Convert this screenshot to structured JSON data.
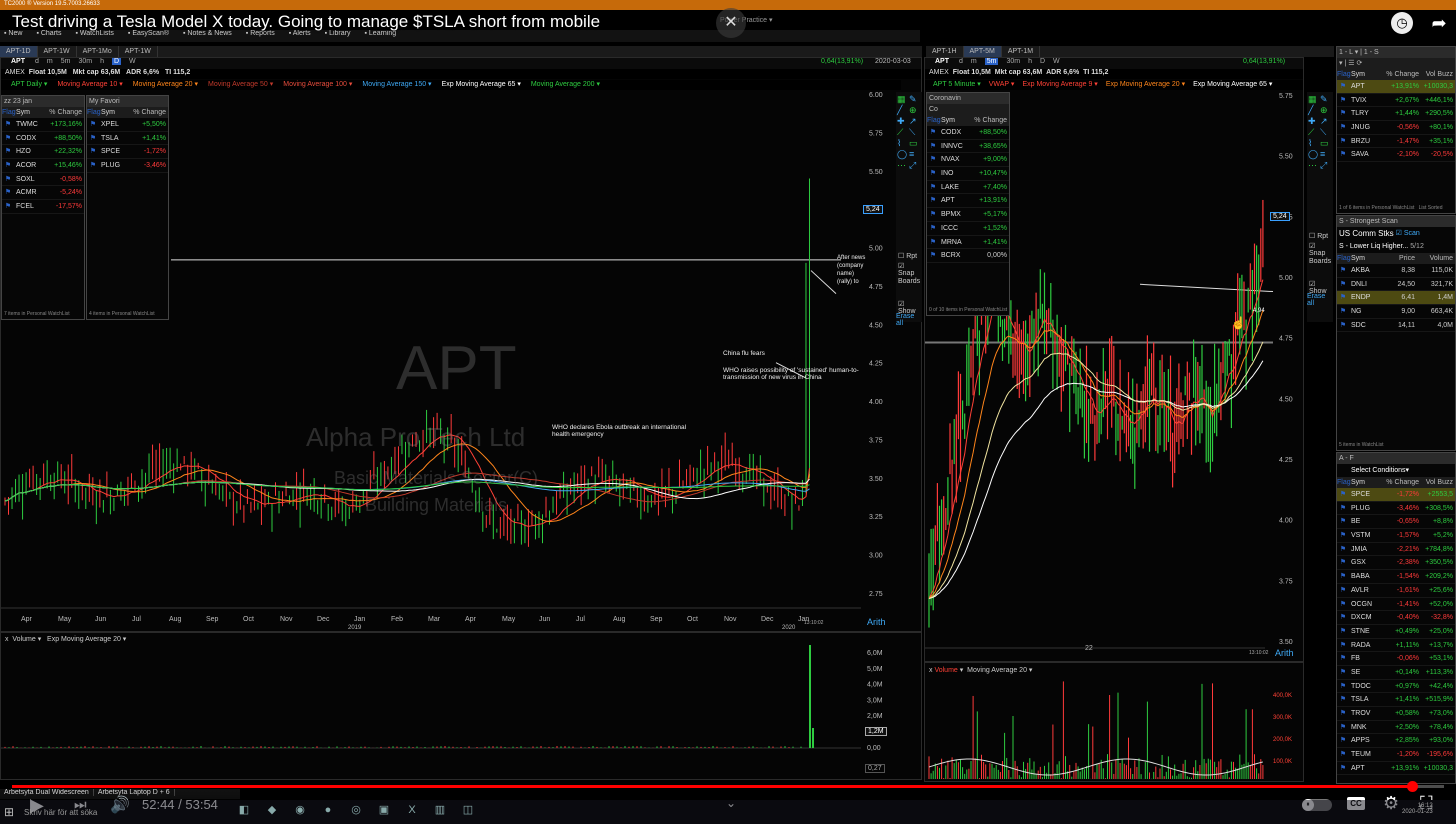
{
  "app_title": "TC2000 ® Version 19.5.7003.26633",
  "video_title": "Test driving a Tesla Model X today. Going to manage $TSLA short from mobile",
  "top_menu": [
    "New",
    "Charts",
    "WatchLists",
    "EasyScan®",
    "Notes & News",
    "Reports",
    "Alerts",
    "Library",
    "Learning"
  ],
  "layout_label": "Power Practice",
  "left_tabs": [
    "APT-1D",
    "APT-1W",
    "APT-1Mo",
    "APT-1W"
  ],
  "right_tabs": [
    "APT-1H",
    "APT-5M",
    "APT-1M"
  ],
  "left_chart": {
    "symbol": "APT",
    "timeframes": [
      "d",
      "m",
      "5m",
      "30m",
      "h",
      "D",
      "W"
    ],
    "exchange": "AMEX",
    "float": "Float 10,5M",
    "mktcap": "Mkt cap 63,6M",
    "adr": "ADR 6,6%",
    "ti": "TI 115,2",
    "price_label": "0,64(13,91%)",
    "date_label": "2020-03-03",
    "indicators": [
      "APT Daily",
      "Moving Average 10",
      "Moving Average 20",
      "Moving Average 50",
      "Moving Average 100",
      "Moving Average 150",
      "Exp Moving Average 65",
      "Moving Average 200"
    ],
    "indicator_colors": [
      "#2ecc40",
      "#ff4136",
      "#ff851b",
      "#c0392b",
      "#e74c3c",
      "#3fa9f5",
      "#ffffff",
      "#2ecc40"
    ],
    "watermark": {
      "symbol": "APT",
      "company": "Alpha Pro Tech Ltd",
      "sector": "Basic Materials Sector(C)",
      "industry": "Building Materials"
    },
    "y_ticks": [
      "6.00",
      "5.75",
      "5.50",
      "5.25",
      "5.00",
      "4.75",
      "4.50",
      "4.25",
      "4.00",
      "3.75",
      "3.50",
      "3.25",
      "3.00",
      "2.75"
    ],
    "price_tag": "5,24",
    "x_ticks": [
      "Apr",
      "May",
      "Jun",
      "Jul",
      "Aug",
      "Sep",
      "Oct",
      "Nov",
      "Dec",
      "Jan",
      "Feb",
      "Mar",
      "Apr",
      "May",
      "Jun",
      "Jul",
      "Aug",
      "Sep",
      "Oct",
      "Nov",
      "Dec",
      "Jan"
    ],
    "x_years": [
      "2019",
      "2020"
    ],
    "scale": "Arith",
    "annotations": [
      "WHO declares Ebola outbreak an international health emergency",
      "China flu fears",
      "WHO raises possibility of 'sustained' human-to-transmission of new virus in China",
      "After news",
      "(company name)",
      "(rally) to"
    ],
    "volume_label": "Volume",
    "volume_ma": "Exp Moving Average 20",
    "vol_ticks": [
      "6,0M",
      "5,0M",
      "4,0M",
      "3,0M",
      "2,0M",
      "1,0M",
      "0,00"
    ],
    "vol_tag": "1,2M",
    "time_label": "13:10:02",
    "small_tag": "0,27"
  },
  "left_watch1": {
    "title": "zz 23 jan",
    "cols": [
      "Flag",
      "Sym",
      "% Change"
    ],
    "rows": [
      {
        "sym": "TWMC",
        "chg": "+173,16%",
        "dir": "pos"
      },
      {
        "sym": "CODX",
        "chg": "+88,50%",
        "dir": "pos"
      },
      {
        "sym": "HZO",
        "chg": "+22,32%",
        "dir": "pos"
      },
      {
        "sym": "ACOR",
        "chg": "+15,46%",
        "dir": "pos"
      },
      {
        "sym": "SOXL",
        "chg": "-0,58%",
        "dir": "neg"
      },
      {
        "sym": "ACMR",
        "chg": "-5,24%",
        "dir": "neg"
      },
      {
        "sym": "FCEL",
        "chg": "-17,57%",
        "dir": "neg"
      }
    ],
    "footer": "7 items in Personal WatchList"
  },
  "left_watch2": {
    "title": "My Favori",
    "cols": [
      "Flag",
      "Sym",
      "% Change"
    ],
    "rows": [
      {
        "sym": "XPEL",
        "chg": "+5,50%",
        "dir": "pos"
      },
      {
        "sym": "TSLA",
        "chg": "+1,41%",
        "dir": "pos"
      },
      {
        "sym": "SPCE",
        "chg": "-1,72%",
        "dir": "neg"
      },
      {
        "sym": "PLUG",
        "chg": "-3,46%",
        "dir": "neg"
      }
    ],
    "footer": "4 items in Personal WatchList"
  },
  "right_chart": {
    "symbol": "APT",
    "timeframes": [
      "d",
      "m",
      "5m",
      "30m",
      "h",
      "D",
      "W"
    ],
    "exchange": "AMEX",
    "float": "Float 10,5M",
    "mktcap": "Mkt cap 63,6M",
    "adr": "ADR 6,6%",
    "ti": "TI 115,2",
    "price_label": "0,64(13,91%)",
    "date_label": "2020-03-03",
    "indicators": [
      "APT 5 Minute",
      "VWAP",
      "Exp Moving Average 9",
      "Exp Moving Average 20",
      "Exp Moving Average 65"
    ],
    "y_ticks": [
      "5.75",
      "5.50",
      "5.25",
      "5.00",
      "4.75",
      "4.50",
      "4.25",
      "4.00",
      "3.75",
      "3.50"
    ],
    "price_tag": "5,24",
    "price_tag2": "4,94",
    "x_tick": "22",
    "scale": "Arith",
    "time_label": "13:10:02",
    "volume_label": "Volume",
    "volume_ma": "Moving Average 20",
    "vol_ticks": [
      "400,0K",
      "300,0K",
      "200,0K",
      "100,0K",
      "0,00"
    ]
  },
  "corona_watch": {
    "title": "Coronavin",
    "subtitle": "Co",
    "cols": [
      "Flag",
      "Sym",
      "% Change"
    ],
    "rows": [
      {
        "sym": "CODX",
        "chg": "+88,50%",
        "dir": "pos"
      },
      {
        "sym": "INNVC",
        "chg": "+38,65%",
        "dir": "pos"
      },
      {
        "sym": "NVAX",
        "chg": "+9,00%",
        "dir": "pos"
      },
      {
        "sym": "INO",
        "chg": "+10,47%",
        "dir": "pos"
      },
      {
        "sym": "LAKE",
        "chg": "+7,40%",
        "dir": "pos"
      },
      {
        "sym": "APT",
        "chg": "+13,91%",
        "dir": "pos"
      },
      {
        "sym": "BPMX",
        "chg": "+5,17%",
        "dir": "pos"
      },
      {
        "sym": "ICCC",
        "chg": "+1,52%",
        "dir": "pos"
      },
      {
        "sym": "MRNA",
        "chg": "+1,41%",
        "dir": "pos"
      },
      {
        "sym": "BCRX",
        "chg": "0,00%",
        "dir": "neu"
      }
    ],
    "footer": "0 of 10 items in Personal WatchList"
  },
  "side_tools": {
    "rpt": "Rpt",
    "snap": "Snap",
    "boards": "Boards",
    "show": "Show",
    "erase": "Erase all"
  },
  "top_right_watch": {
    "cols": [
      "Flag",
      "Sym",
      "% Change",
      "Vol Buzz"
    ],
    "rows": [
      {
        "sym": "APT",
        "chg": "+13,91%",
        "buzz": "+10030,3",
        "dir": "pos",
        "sel": true
      },
      {
        "sym": "TVIX",
        "chg": "+2,67%",
        "buzz": "+446,1%",
        "dir": "pos"
      },
      {
        "sym": "TLRY",
        "chg": "+1,44%",
        "buzz": "+290,5%",
        "dir": "pos"
      },
      {
        "sym": "JNUG",
        "chg": "-0,56%",
        "buzz": "+80,1%",
        "dir": "neg"
      },
      {
        "sym": "BRZU",
        "chg": "-1,47%",
        "buzz": "+35,1%",
        "dir": "neg"
      },
      {
        "sym": "SAVA",
        "chg": "-2,10%",
        "buzz": "-20,5%",
        "dir": "neg"
      }
    ],
    "footer": "1 of 6 items in Personal WatchList",
    "footer2": "List Sorted"
  },
  "scan": {
    "title": "S - Strongest Scan",
    "list": "US Comm Stks",
    "scan_btn": "Scan",
    "filter": "S - Lower Liq Higher...",
    "count": "5/12",
    "cols": [
      "Flag",
      "Sym",
      "Price",
      "Volume"
    ],
    "rows": [
      {
        "sym": "AKBA",
        "price": "8,38",
        "vol": "115,0K"
      },
      {
        "sym": "DNLI",
        "price": "24,50",
        "vol": "321,7K"
      },
      {
        "sym": "ENDP",
        "price": "6,41",
        "vol": "1,4M",
        "sel": true
      },
      {
        "sym": "NG",
        "price": "9,00",
        "vol": "663,4K"
      },
      {
        "sym": "SDC",
        "price": "14,11",
        "vol": "4,0M"
      }
    ],
    "footer": "5 items in WatchList"
  },
  "bottom_right_watch": {
    "title": "A - F",
    "conditions": "Select Conditions",
    "cols": [
      "Flag",
      "Sym",
      "% Change",
      "Vol Buzz"
    ],
    "rows": [
      {
        "sym": "SPCE",
        "chg": "-1,72%",
        "buzz": "+2553,5",
        "dir": "neg",
        "sel": true
      },
      {
        "sym": "PLUG",
        "chg": "-3,46%",
        "buzz": "+308,5%",
        "dir": "neg"
      },
      {
        "sym": "BE",
        "chg": "-0,65%",
        "buzz": "+8,8%",
        "dir": "neg"
      },
      {
        "sym": "VSTM",
        "chg": "-1,57%",
        "buzz": "+5,2%",
        "dir": "neg"
      },
      {
        "sym": "JMIA",
        "chg": "-2,21%",
        "buzz": "+784,8%",
        "dir": "neg"
      },
      {
        "sym": "GSX",
        "chg": "-2,38%",
        "buzz": "+350,5%",
        "dir": "neg"
      },
      {
        "sym": "BABA",
        "chg": "-1,54%",
        "buzz": "+209,2%",
        "dir": "neg"
      },
      {
        "sym": "AVLR",
        "chg": "-1,61%",
        "buzz": "+25,6%",
        "dir": "neg"
      },
      {
        "sym": "OCGN",
        "chg": "-1,41%",
        "buzz": "+52,0%",
        "dir": "neg"
      },
      {
        "sym": "DXCM",
        "chg": "-0,40%",
        "buzz": "-32,8%",
        "dir": "neg"
      },
      {
        "sym": "STNE",
        "chg": "+0,49%",
        "buzz": "+25,0%",
        "dir": "pos"
      },
      {
        "sym": "RADA",
        "chg": "+1,11%",
        "buzz": "+13,7%",
        "dir": "pos"
      },
      {
        "sym": "FB",
        "chg": "-0,06%",
        "buzz": "+53,1%",
        "dir": "neg"
      },
      {
        "sym": "SE",
        "chg": "+0,14%",
        "buzz": "+113,3%",
        "dir": "pos"
      },
      {
        "sym": "TDOC",
        "chg": "+0,97%",
        "buzz": "+42,4%",
        "dir": "pos"
      },
      {
        "sym": "TSLA",
        "chg": "+1,41%",
        "buzz": "+515,9%",
        "dir": "pos"
      },
      {
        "sym": "TROV",
        "chg": "+0,58%",
        "buzz": "+73,0%",
        "dir": "pos"
      },
      {
        "sym": "MNK",
        "chg": "+2,50%",
        "buzz": "+78,4%",
        "dir": "pos"
      },
      {
        "sym": "APPS",
        "chg": "+2,85%",
        "buzz": "+93,0%",
        "dir": "pos"
      },
      {
        "sym": "TEUM",
        "chg": "-1,20%",
        "buzz": "-195,6%",
        "dir": "neg"
      },
      {
        "sym": "APT",
        "chg": "+13,91%",
        "buzz": "+10030,3",
        "dir": "pos"
      }
    ]
  },
  "layout_tabs": [
    "Arbetsyta Dual Widescreen",
    "Arbetsyta Laptop D + 6"
  ],
  "player": {
    "time": "52:44 / 53:54",
    "progress": 0.978
  },
  "taskbar": {
    "search": "Skriv här för att söka",
    "clock": "16:12",
    "date": "2020-01-23"
  },
  "yt_overlay": {
    "watch_later": "Titta senare",
    "share": "Dela"
  }
}
